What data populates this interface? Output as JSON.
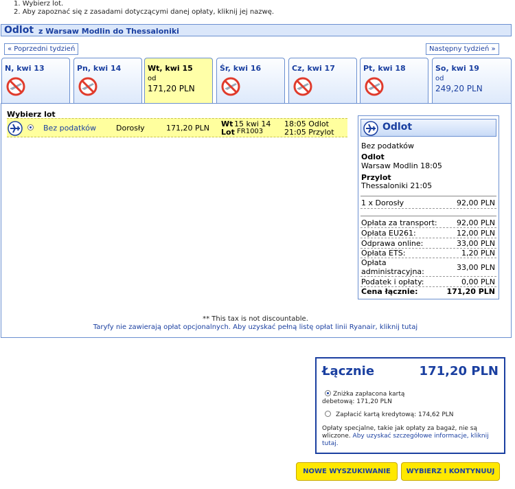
{
  "instructions": [
    "1.  Wybierz lot.",
    "2.  Aby zapoznać się z zasadami dotyczącymi danej opłaty, kliknij jej nazwę."
  ],
  "header": {
    "direction": "Odlot",
    "route": "z Warsaw Modlin do Thessaloniki"
  },
  "week_nav": {
    "prev": "« Poprzedni tydzień",
    "next": "Następny tydzień »"
  },
  "days": [
    {
      "label": "N, kwi 13",
      "available": false
    },
    {
      "label": "Pn, kwi 14",
      "available": false
    },
    {
      "label": "Wt, kwi 15",
      "available": true,
      "from": "od",
      "price": "171,20 PLN",
      "selected": true
    },
    {
      "label": "Śr, kwi 16",
      "available": false
    },
    {
      "label": "Cz, kwi 17",
      "available": false
    },
    {
      "label": "Pt, kwi 18",
      "available": false
    },
    {
      "label": "So, kwi 19",
      "available": true,
      "from": "od",
      "price": "249,20 PLN"
    }
  ],
  "flight_list": {
    "title": "Wybierz lot",
    "flight": {
      "fare": "Bez podatków",
      "passenger": "Dorosły",
      "price": "171,20 PLN",
      "day": "Wt",
      "date": "15 kwi 14",
      "flight_label": "Lot",
      "flight_no": "FR1003",
      "dep_time": "18:05 Odlot",
      "arr_time": "21:05 Przylot"
    }
  },
  "summary": {
    "title": "Odlot",
    "fare": "Bez podatków",
    "dep_label": "Odlot",
    "dep_value": "Warsaw Modlin 18:05",
    "arr_label": "Przylot",
    "arr_value": "Thessaloniki 21:05",
    "pax_label": "1 x Dorosły",
    "pax_value": "92,00 PLN",
    "fees": [
      {
        "label": "Opłata za transport:",
        "value": "92,00 PLN"
      },
      {
        "label": "Opłata EU261:",
        "value": "12,00 PLN"
      },
      {
        "label": "Odprawa online:",
        "value": "33,00 PLN"
      },
      {
        "label": "Opłata ETS:",
        "value": "1,20 PLN"
      },
      {
        "label": "Opłata administracyjna:",
        "value": "33,00 PLN"
      },
      {
        "label": "Podatek i opłaty:",
        "value": "0,00 PLN"
      }
    ],
    "total_label": "Cena łącznie:",
    "total_value": "171,20 PLN"
  },
  "footnote": "** This tax is not discountable.",
  "footnote_link": "Taryfy nie zawierają opłat opcjonalnych. Aby uzyskać pełną listę opłat linii Ryanair, kliknij tutaj",
  "total": {
    "label": "Łącznie",
    "amount": "171,20 PLN",
    "opt_debit": "Zniżka zapłacona kartą debetową: 171,20 PLN",
    "opt_credit": "Zapłacić kartą kredytową: 174,62 PLN",
    "note": "Opłaty specjalne, takie jak opłaty za bagaż, nie są wliczone.",
    "note_link": "Aby uzyskać szczegółowe informacje, kliknij tutaj."
  },
  "buttons": {
    "new_search": "NOWE WYSZUKIWANIE",
    "continue": "WYBIERZ I KONTYNUUJ"
  }
}
